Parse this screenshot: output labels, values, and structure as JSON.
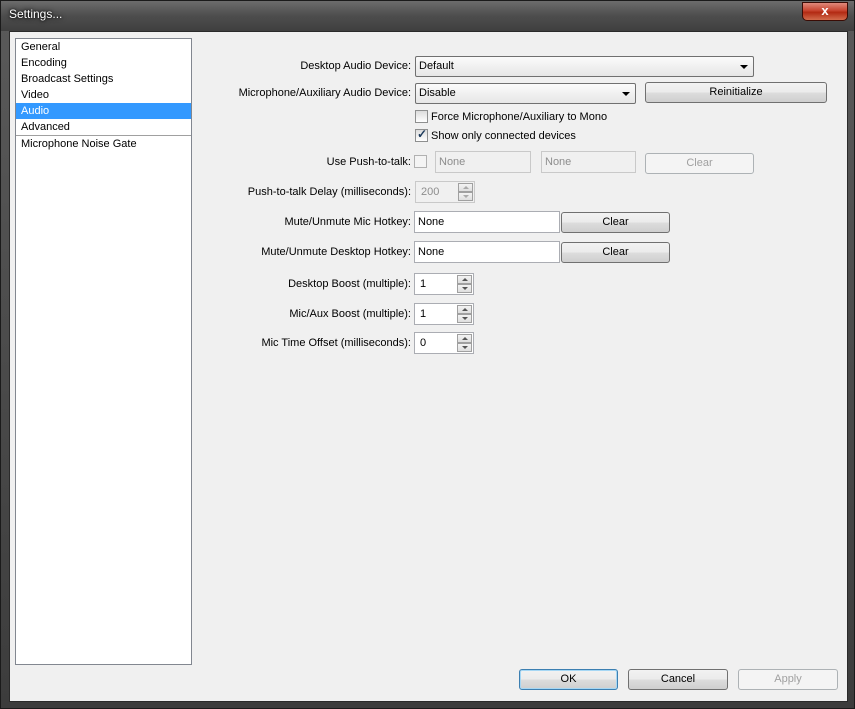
{
  "window": {
    "title": "Settings...",
    "close_glyph": "x"
  },
  "nav": {
    "items": [
      "General",
      "Encoding",
      "Broadcast Settings",
      "Video",
      "Audio",
      "Advanced"
    ],
    "plugins": [
      "Microphone Noise Gate"
    ],
    "selected": "Audio"
  },
  "audio": {
    "desktop_device_label": "Desktop Audio Device:",
    "desktop_device_value": "Default",
    "mic_device_label": "Microphone/Auxiliary Audio Device:",
    "mic_device_value": "Disable",
    "reinitialize_label": "Reinitialize",
    "force_mono_label": "Force Microphone/Auxiliary to Mono",
    "force_mono_checked": false,
    "show_connected_label": "Show only connected devices",
    "show_connected_checked": true,
    "ptt_label": "Use Push-to-talk:",
    "ptt_checked": false,
    "ptt_hotkey1": "None",
    "ptt_hotkey2": "None",
    "ptt_clear_label": "Clear",
    "ptt_delay_label": "Push-to-talk Delay (milliseconds):",
    "ptt_delay_value": "200",
    "mute_mic_label": "Mute/Unmute Mic Hotkey:",
    "mute_mic_value": "None",
    "mute_mic_clear_label": "Clear",
    "mute_desktop_label": "Mute/Unmute Desktop Hotkey:",
    "mute_desktop_value": "None",
    "mute_desktop_clear_label": "Clear",
    "desktop_boost_label": "Desktop Boost (multiple):",
    "desktop_boost_value": "1",
    "mic_boost_label": "Mic/Aux Boost (multiple):",
    "mic_boost_value": "1",
    "mic_offset_label": "Mic Time Offset (milliseconds):",
    "mic_offset_value": "0"
  },
  "footer": {
    "ok_label": "OK",
    "cancel_label": "Cancel",
    "apply_label": "Apply"
  },
  "colors": {
    "selection": "#3399ff",
    "dialog_bg": "#f0f0f0",
    "close_red": "#c7432e"
  }
}
